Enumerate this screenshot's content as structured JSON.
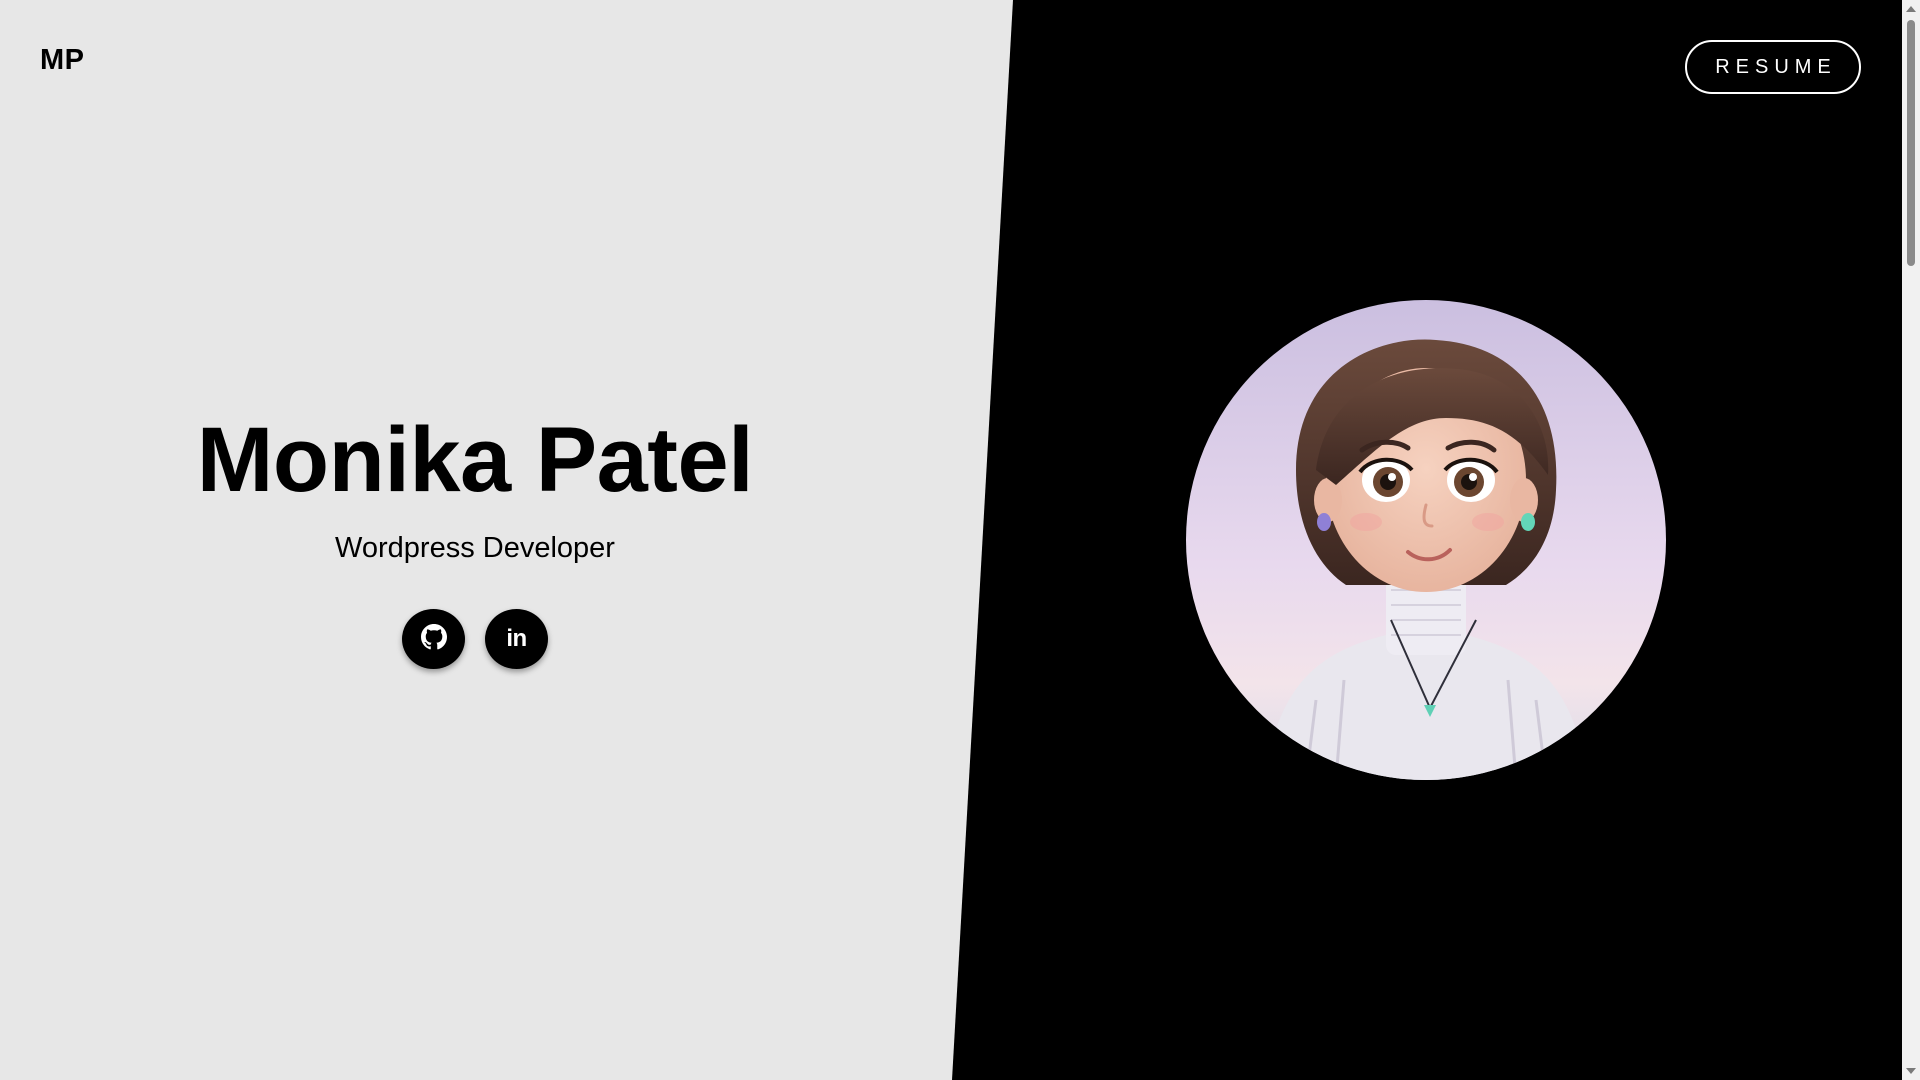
{
  "header": {
    "logo_text": "MP",
    "resume_label": "RESUME"
  },
  "hero": {
    "name": "Monika Patel",
    "role": "Wordpress Developer"
  },
  "socials": [
    {
      "name": "github",
      "icon": "github-icon"
    },
    {
      "name": "linkedin",
      "icon": "linkedin-icon",
      "glyph": "in"
    }
  ],
  "avatar": {
    "icon": "cartoon-portrait"
  },
  "colors": {
    "left_panel": "#e7e7e7",
    "right_panel": "#000000",
    "text": "#000000",
    "button_border": "#ffffff"
  }
}
